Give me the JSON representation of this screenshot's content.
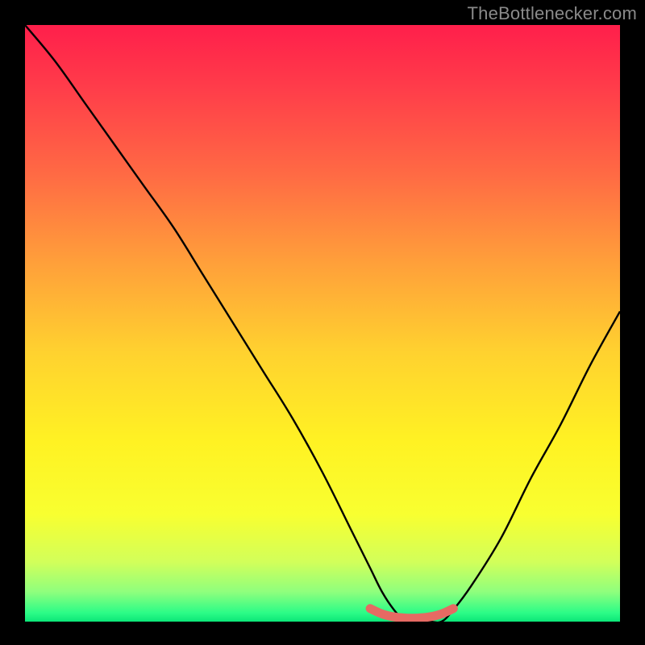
{
  "attribution": "TheBottlenecker.com",
  "chart_data": {
    "type": "line",
    "title": "",
    "xlabel": "",
    "ylabel": "",
    "xlim": [
      0,
      100
    ],
    "ylim": [
      0,
      100
    ],
    "series": [
      {
        "name": "curve",
        "x": [
          0,
          5,
          10,
          15,
          20,
          25,
          30,
          35,
          40,
          45,
          50,
          55,
          58,
          60,
          62,
          64,
          66,
          68,
          70,
          72,
          75,
          80,
          85,
          90,
          95,
          100
        ],
        "values": [
          100,
          94,
          87,
          80,
          73,
          66,
          58,
          50,
          42,
          34,
          25,
          15,
          9,
          5,
          2,
          0,
          0,
          0,
          0,
          2,
          6,
          14,
          24,
          33,
          43,
          52
        ]
      },
      {
        "name": "highlight",
        "x": [
          58,
          60,
          62,
          64,
          66,
          68,
          70,
          72
        ],
        "values": [
          2.2,
          1.3,
          0.8,
          0.6,
          0.6,
          0.8,
          1.3,
          2.2
        ]
      }
    ],
    "gradient_stops": [
      {
        "offset": 0.0,
        "color": "#ff1f4b"
      },
      {
        "offset": 0.1,
        "color": "#ff3b4a"
      },
      {
        "offset": 0.25,
        "color": "#ff6a44"
      },
      {
        "offset": 0.4,
        "color": "#ffa03a"
      },
      {
        "offset": 0.55,
        "color": "#ffd22f"
      },
      {
        "offset": 0.7,
        "color": "#fff223"
      },
      {
        "offset": 0.82,
        "color": "#f8ff30"
      },
      {
        "offset": 0.9,
        "color": "#d2ff5a"
      },
      {
        "offset": 0.95,
        "color": "#8fff7d"
      },
      {
        "offset": 0.985,
        "color": "#2dfc87"
      },
      {
        "offset": 1.0,
        "color": "#0be678"
      }
    ],
    "highlight_color": "#e66a63",
    "curve_color": "#000000"
  }
}
